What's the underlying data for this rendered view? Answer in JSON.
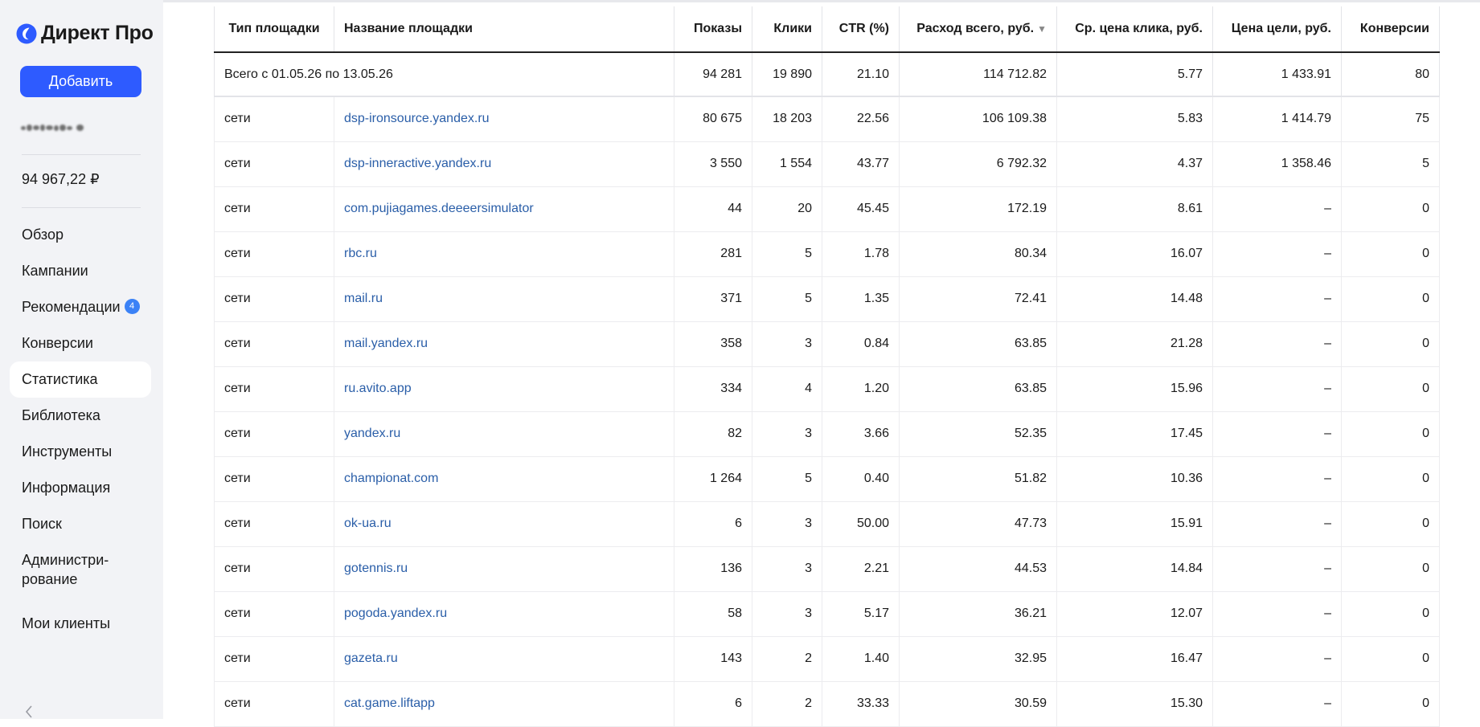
{
  "app": {
    "logo_text": "Директ Про",
    "add_button": "Добавить",
    "balance": "94 967,22 ₽",
    "nav": [
      {
        "label": "Обзор"
      },
      {
        "label": "Кампании"
      },
      {
        "label": "Рекомендации",
        "badge": "4"
      },
      {
        "label": "Конверсии"
      },
      {
        "label": "Статистика",
        "active": true
      },
      {
        "label": "Библиотека"
      },
      {
        "label": "Инструменты"
      },
      {
        "label": "Информация"
      },
      {
        "label": "Поиск"
      },
      {
        "label_line1": "Администри-",
        "label_line2": "рование"
      },
      {
        "label": "Мои клиенты"
      }
    ],
    "accent_color": "#2e5bff",
    "badge_color": "#3b82f6",
    "link_color": "#2a5ea8",
    "icons": {
      "logo": "direct-logo-icon",
      "collapse": "chevron-left-icon",
      "sort": "sort-desc-icon"
    }
  },
  "table": {
    "total": {
      "label": "Всего с 01.05.26 по 13.05.26",
      "shows": "94 281",
      "clicks": "19 890",
      "ctr": "21.10",
      "spend": "114 712.82",
      "cpc": "5.77",
      "goal_price": "1 433.91",
      "conversions": "80"
    },
    "headers": {
      "type": "Тип площадки",
      "name": "Название площадки",
      "shows": "Показы",
      "clicks": "Клики",
      "ctr": "CTR (%)",
      "spend": "Расход всего, руб.",
      "cpc": "Ср. цена клика, руб.",
      "goal_price": "Цена цели, руб.",
      "conversions": "Конверсии"
    },
    "rows": [
      {
        "type": "сети",
        "name": "dsp-ironsource.yandex.ru",
        "shows": "80 675",
        "clicks": "18 203",
        "ctr": "22.56",
        "spend": "106 109.38",
        "cpc": "5.83",
        "goal_price": "1 414.79",
        "conversions": "75"
      },
      {
        "type": "сети",
        "name": "dsp-inneractive.yandex.ru",
        "shows": "3 550",
        "clicks": "1 554",
        "ctr": "43.77",
        "spend": "6 792.32",
        "cpc": "4.37",
        "goal_price": "1 358.46",
        "conversions": "5"
      },
      {
        "type": "сети",
        "name": "com.pujiagames.deeeersimulator",
        "shows": "44",
        "clicks": "20",
        "ctr": "45.45",
        "spend": "172.19",
        "cpc": "8.61",
        "goal_price": "–",
        "conversions": "0"
      },
      {
        "type": "сети",
        "name": "rbc.ru",
        "shows": "281",
        "clicks": "5",
        "ctr": "1.78",
        "spend": "80.34",
        "cpc": "16.07",
        "goal_price": "–",
        "conversions": "0"
      },
      {
        "type": "сети",
        "name": "mail.ru",
        "shows": "371",
        "clicks": "5",
        "ctr": "1.35",
        "spend": "72.41",
        "cpc": "14.48",
        "goal_price": "–",
        "conversions": "0"
      },
      {
        "type": "сети",
        "name": "mail.yandex.ru",
        "shows": "358",
        "clicks": "3",
        "ctr": "0.84",
        "spend": "63.85",
        "cpc": "21.28",
        "goal_price": "–",
        "conversions": "0"
      },
      {
        "type": "сети",
        "name": "ru.avito.app",
        "shows": "334",
        "clicks": "4",
        "ctr": "1.20",
        "spend": "63.85",
        "cpc": "15.96",
        "goal_price": "–",
        "conversions": "0"
      },
      {
        "type": "сети",
        "name": "yandex.ru",
        "shows": "82",
        "clicks": "3",
        "ctr": "3.66",
        "spend": "52.35",
        "cpc": "17.45",
        "goal_price": "–",
        "conversions": "0"
      },
      {
        "type": "сети",
        "name": "championat.com",
        "shows": "1 264",
        "clicks": "5",
        "ctr": "0.40",
        "spend": "51.82",
        "cpc": "10.36",
        "goal_price": "–",
        "conversions": "0"
      },
      {
        "type": "сети",
        "name": "ok-ua.ru",
        "shows": "6",
        "clicks": "3",
        "ctr": "50.00",
        "spend": "47.73",
        "cpc": "15.91",
        "goal_price": "–",
        "conversions": "0"
      },
      {
        "type": "сети",
        "name": "gotennis.ru",
        "shows": "136",
        "clicks": "3",
        "ctr": "2.21",
        "spend": "44.53",
        "cpc": "14.84",
        "goal_price": "–",
        "conversions": "0"
      },
      {
        "type": "сети",
        "name": "pogoda.yandex.ru",
        "shows": "58",
        "clicks": "3",
        "ctr": "5.17",
        "spend": "36.21",
        "cpc": "12.07",
        "goal_price": "–",
        "conversions": "0"
      },
      {
        "type": "сети",
        "name": "gazeta.ru",
        "shows": "143",
        "clicks": "2",
        "ctr": "1.40",
        "spend": "32.95",
        "cpc": "16.47",
        "goal_price": "–",
        "conversions": "0"
      },
      {
        "type": "сети",
        "name": "cat.game.liftapp",
        "shows": "6",
        "clicks": "2",
        "ctr": "33.33",
        "spend": "30.59",
        "cpc": "15.30",
        "goal_price": "–",
        "conversions": "0"
      }
    ]
  }
}
